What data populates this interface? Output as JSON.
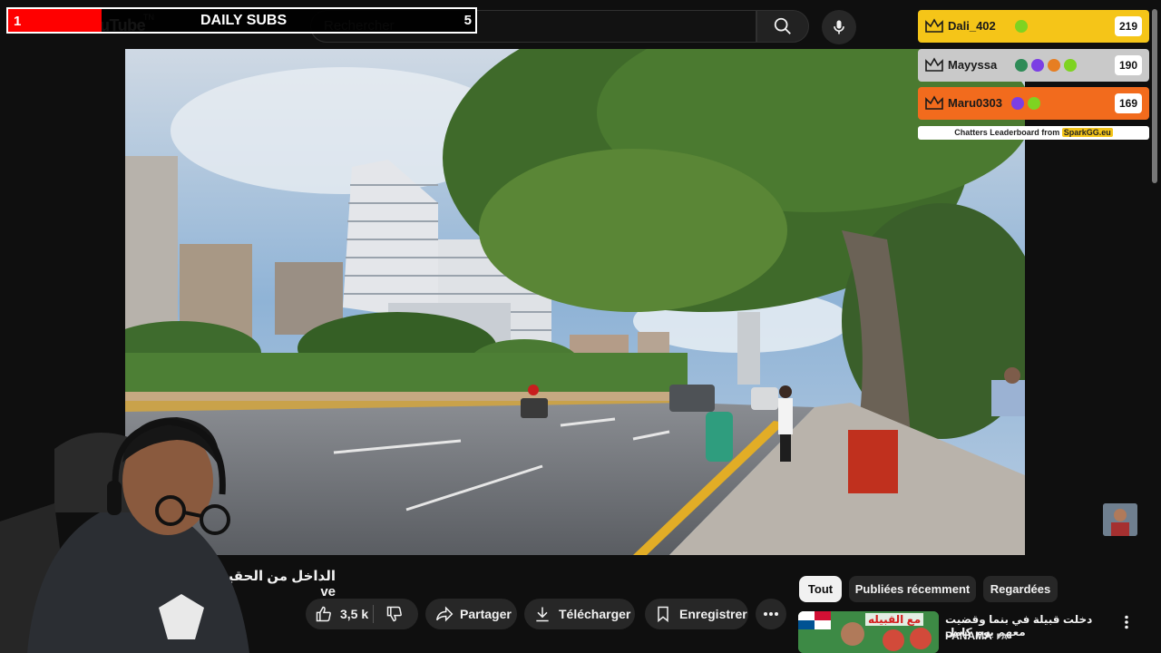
{
  "header": {
    "logo_text": "uTube",
    "logo_superscript": "TN",
    "search_placeholder": "Rechercher"
  },
  "subs_goal": {
    "title": "DAILY SUBS",
    "current": "1",
    "goal": "5",
    "progress": 0.2,
    "fill_color": "#ff0000"
  },
  "leaderboard": {
    "entries": [
      {
        "rank": 1,
        "name": "Dali_402",
        "score": "219",
        "color": "#f5c518"
      },
      {
        "rank": 2,
        "name": "Mayyssa",
        "score": "190",
        "color": "#c9c9c9"
      },
      {
        "rank": 3,
        "name": "Maru0303",
        "score": "169",
        "color": "#f26b1d"
      }
    ],
    "footer_text": "Chatters Leaderboard from",
    "footer_brand": "SparkGG.eu"
  },
  "video": {
    "title": "الداخل من الحقيقة ve"
  },
  "actions": {
    "like_count": "3,5 k",
    "share": "Partager",
    "download": "Télécharger",
    "save": "Enregistrer"
  },
  "chips": [
    {
      "label": "Tout",
      "active": true
    },
    {
      "label": "Publiées récemment",
      "active": false
    },
    {
      "label": "Regardées",
      "active": false
    }
  ],
  "recommendation": {
    "title": "دخلت قبيلة في بنما وقضيت معهم يوم كامل",
    "channel": "PANAMA",
    "channel_suffix": "PA",
    "thumb_text": "مع القبيله"
  }
}
